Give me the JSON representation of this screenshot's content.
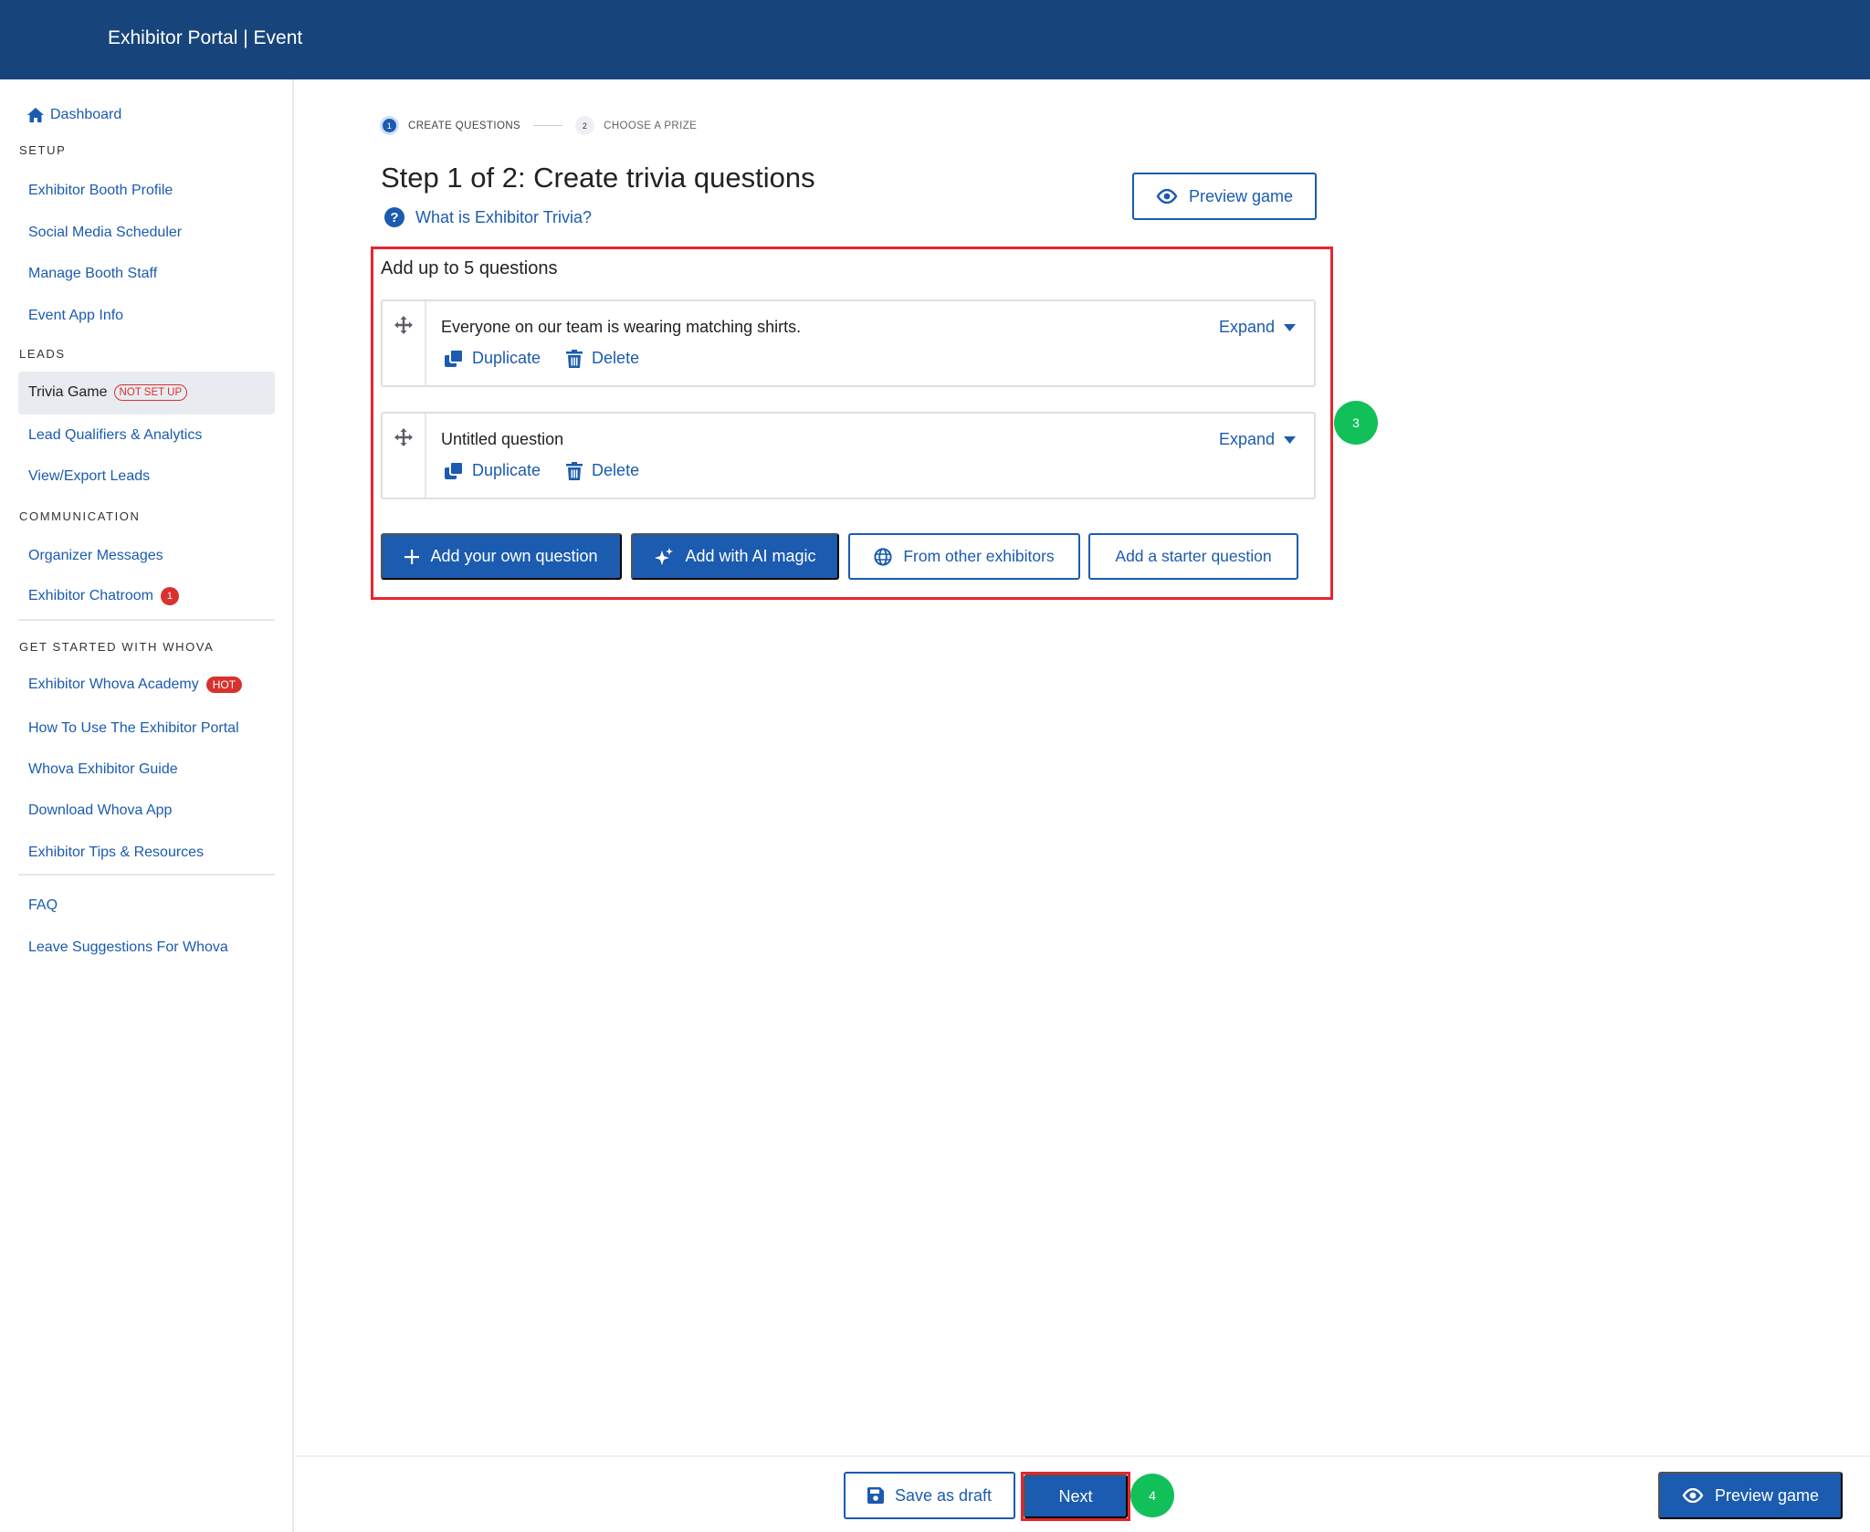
{
  "header": {
    "title": "Exhibitor Portal | Event"
  },
  "sidebar": {
    "dashboard_label": "Dashboard",
    "sections": {
      "setup": "SETUP",
      "leads": "LEADS",
      "communication": "COMMUNICATION",
      "get_started": "GET STARTED WITH WHOVA"
    },
    "setup_items": [
      "Exhibitor Booth Profile",
      "Social Media Scheduler",
      "Manage Booth Staff",
      "Event App Info"
    ],
    "leads_items": {
      "active": "Trivia Game",
      "active_badge": "NOT SET UP",
      "lead_qualifiers": "Lead Qualifiers & Analytics",
      "view_export": "View/Export Leads"
    },
    "communication_items": {
      "organizer_messages": "Organizer Messages",
      "chatroom": "Exhibitor Chatroom",
      "chatroom_count": "1"
    },
    "get_started_items": {
      "academy": "Exhibitor Whova Academy",
      "academy_badge": "HOT",
      "how_to": "How To Use The Exhibitor Portal",
      "guide": "Whova Exhibitor Guide",
      "download": "Download Whova App",
      "tips": "Exhibitor Tips & Resources"
    },
    "extra_items": {
      "faq": "FAQ",
      "suggestions": "Leave Suggestions For Whova"
    }
  },
  "stepper": {
    "step1_number": "1",
    "step1_label": "CREATE QUESTIONS",
    "step2_number": "2",
    "step2_label": "CHOOSE A PRIZE"
  },
  "main": {
    "title": "Step 1 of 2: Create trivia questions",
    "help_link": "What is Exhibitor Trivia?",
    "preview_label": "Preview game",
    "questions_heading": "Add up to 5 questions",
    "questions": [
      {
        "text": "Everyone on our team is wearing matching shirts.",
        "expand": "Expand",
        "duplicate": "Duplicate",
        "delete": "Delete"
      },
      {
        "text": "Untitled question",
        "expand": "Expand",
        "duplicate": "Duplicate",
        "delete": "Delete"
      }
    ],
    "add_buttons": {
      "own": "Add your own question",
      "ai": "Add with AI magic",
      "others": "From other exhibitors",
      "starter": "Add a starter question"
    }
  },
  "markers": {
    "m3": "3",
    "m4": "4"
  },
  "footer": {
    "save_draft": "Save as draft",
    "next": "Next",
    "preview": "Preview game"
  },
  "colors": {
    "header_bg": "#17457b",
    "accent": "#1b5bb0",
    "alert": "#e5262f",
    "marker": "#12c05a"
  }
}
